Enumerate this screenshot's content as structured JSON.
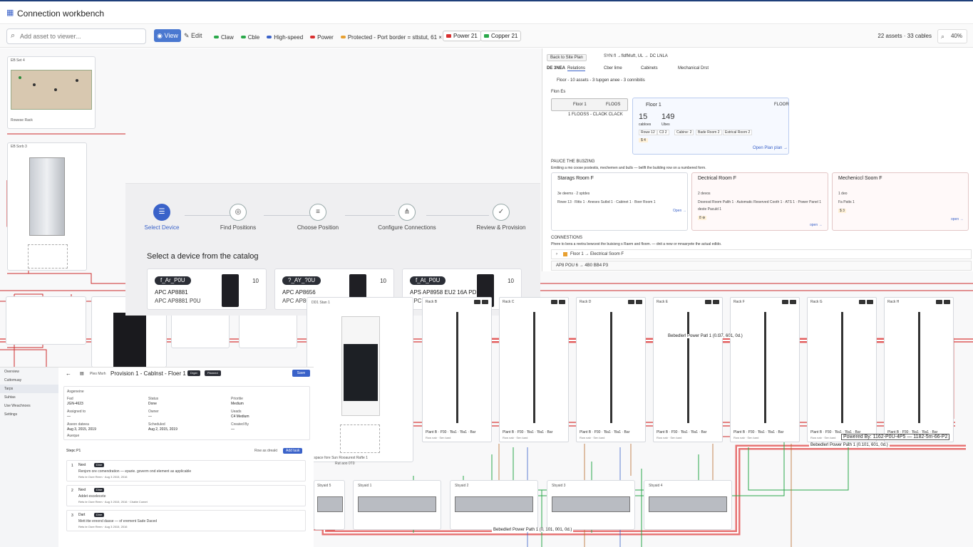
{
  "app": {
    "title": "Connection workbench"
  },
  "toolbar": {
    "search_placeholder": "Add asset to viewer...",
    "view_label": "View",
    "edit_label": "Edit",
    "legend": [
      {
        "label": "Claw",
        "color": "#2aa84a"
      },
      {
        "label": "Cble",
        "color": "#2aa84a"
      },
      {
        "label": "High-speed",
        "color": "#3a62c9"
      },
      {
        "label": "Power",
        "color": "#d93030"
      },
      {
        "label": "Protected - Port border = sttstut, 61 × family",
        "color": "#e8a030"
      }
    ],
    "chip_power": "Power 21",
    "chip_copper": "Copper 21",
    "counts": "22 assets · 33 cables",
    "zoom": "40%"
  },
  "wizard": {
    "steps": [
      {
        "label": "Select Device",
        "icon": "server-icon",
        "glyph": "☰"
      },
      {
        "label": "Find Positions",
        "icon": "location-pin-icon",
        "glyph": "◎"
      },
      {
        "label": "Choose Position",
        "icon": "stack-icon",
        "glyph": "≡"
      },
      {
        "label": "Configure Connections",
        "icon": "connection-icon",
        "glyph": "⋔"
      },
      {
        "label": "Review & Provision",
        "icon": "check-icon",
        "glyph": "✓"
      }
    ],
    "heading": "Select a device from the catalog",
    "devices": [
      {
        "tag": "f_Ar_P0U",
        "name": "APC AP8881",
        "model": "APC AP8881 P0U",
        "count": "10"
      },
      {
        "tag": "?_AY_?0U",
        "name": "APC AP8656",
        "model": "APC AP8656 PDU",
        "count": "10"
      },
      {
        "tag": "f_At_P0U",
        "name": "APS AP8958 EU2 16A PDU",
        "model": "APC AP8958 EU3 16A PDU",
        "count": "10"
      }
    ]
  },
  "right_panel": {
    "back_label": "Back to Site Plan",
    "crumb": "SYN fl  →fldfMuft, UL  →  DC LNLA",
    "tabs": [
      "DE 3NEA",
      "Relations",
      "Cber lime",
      "Cabinets",
      "Mechanical Drst"
    ],
    "floor_line": "Floor - 10 assets - 3 tupgen anee - 3 connibitis",
    "floors_label": "Flon Es",
    "floor_selector": {
      "name": "Floor 1",
      "code": "FLOOS",
      "sub": "1 FLOOSS - CLAOK CLACK"
    },
    "floor_card": {
      "name": "Floor 1",
      "code": "FLOOR",
      "stat1_val": "15",
      "stat1_lab": "cabloes",
      "stat2_val": "149",
      "stat2_lab": "Ubes",
      "chips": [
        "Rowe 12",
        "C3 2",
        "Cabine: 2",
        "Bade Room 2",
        "Estrical Room 2"
      ],
      "warn": "$ 4",
      "link": "Open Plan plan →"
    },
    "rooms_title": "PAUCE THE BU3ZING",
    "rooms_desc": "Emitiing a mo coose postestis, mechemen and bulls — bellft the building row on a numbered form.",
    "rooms": [
      {
        "name": "Starags Room F",
        "l1": "3e deems  · 2 sptdes",
        "l2": "Rowe 13 · Ritts 1 · Aneses Sutbd 1 · Cabinet 1 · Boer Room 1",
        "link": "Open →"
      },
      {
        "name": "Dectrical Room F",
        "l1": "2 devos",
        "l2": "Dosrosd Room Palth 1 · Automatic Reserved Cooth 1 · ATS 1 · Power Panel 1",
        "l3": "deste Paculd 1",
        "l4": "8 ⊕",
        "link": "open →"
      },
      {
        "name": "Mecheniccl Soom F",
        "l1": "1 deo",
        "l2": "Fa Patts 1",
        "l3": "$ 3",
        "link": "open →"
      }
    ],
    "conn_title": "CONNESTIONS",
    "conn_desc": "Phere to bera a reetra bewcest the buisisng s Raem and floom. — dnit a new or mnasryete the actual edldo.",
    "conn_row1": "Floor 1 → Electrical Soom F",
    "conn_row2": "AP8 POU 6 → 4B0 BB4 P3"
  },
  "canvas": {
    "cable_label_1": "Bebedlerl Power Patl 1 (0.l37, 601, 0d.)",
    "cable_label_2": "Bebedlerl Power Path 1 (0.101, 601, 0d.)",
    "cable_label_3": "Bebedlerl Power Path 1 (0, 101, 001, 0d.)",
    "powered_by": "Powered By: 1162-P0U-4P5 — 1182-5m-66-P2",
    "racks": [
      "DD1 Stan 1",
      "Rack B",
      "Rack C",
      "Rack D",
      "Rack E",
      "Rack F",
      "Rack G",
      "Rack H",
      "Rack I",
      "Rack J"
    ],
    "rack_footer": "Plant B · P30 · 'Ba1 · 'Ba1 · Bar",
    "rack_sub": "Row nab · Sen kard",
    "asset_top": "ЕВ Set 4",
    "asset_top_sub": "Rowese Rack",
    "ups_title": "ЕВ Sorb 3",
    "rear_label": "Ebeyi Rout  20 · Scar dual",
    "server_labels": [
      "Sbyaid 1",
      "Sbyaid 2",
      "Sbyaid 3",
      "Sbyaid 4",
      "Sbyaid 5"
    ],
    "mid_bottom": "Espace fore  Sun  Rooaurest Rafte 1",
    "mid_bottom2": "Rut  aoo  0T0"
  },
  "detail": {
    "nav": [
      "Overview",
      "Cuttomuay",
      "Tarps",
      "Suhtas",
      "Use Weachnoes",
      "Settings"
    ],
    "crumb": "Pleo Msrh",
    "title": "Provision 1 - Cablnst - Floer 1",
    "badge1": "Drger",
    "badge2": "Planned",
    "save": "Save",
    "meta": [
      {
        "label": "Asgeneine",
        "value": ""
      },
      {
        "label": "Fad",
        "value": "JGN-4623"
      },
      {
        "label": "Status",
        "value": "Done"
      },
      {
        "label": "Prioritie",
        "value": "Medium"
      },
      {
        "label": "Assigned to",
        "value": "—"
      },
      {
        "label": "Owner",
        "value": "—"
      },
      {
        "label": "Ueads",
        "value": "C4 Medium"
      },
      {
        "label": "Aseon dateea",
        "value": "Aug 3, 2015, 2019"
      },
      {
        "label": "Scheduled",
        "value": "Aug 2, 2015, 2019"
      },
      {
        "label": "Created By",
        "value": "—"
      },
      {
        "label": "Aueque",
        "value": "—"
      }
    ],
    "tasks_title": "Stepc P1",
    "tasks_action1": "Row as dreakt",
    "tasks_action2": "Add task",
    "tasks": [
      {
        "num": "1",
        "status": "Next",
        "pill": "Dine",
        "l1": "Renjom ore comendration — eparie. goverm ond element as applicable",
        "l2": "Rets te Oore Rerm · Aug 3 2015, 2016"
      },
      {
        "num": "2",
        "status": "Next",
        "pill": "Dine",
        "l1": "Addet escelecete",
        "l2": "Rets te Oore Rerm · Aug 3 2015, 2016  ·  Chatte Comet"
      },
      {
        "num": "3",
        "status": "Dart",
        "pill": "Dine",
        "l1": "Mett itte ereond dasse — of erement Sade Daced",
        "l2": "Rets te Oore Rerm · Aug 3 2015, 2016"
      }
    ]
  }
}
